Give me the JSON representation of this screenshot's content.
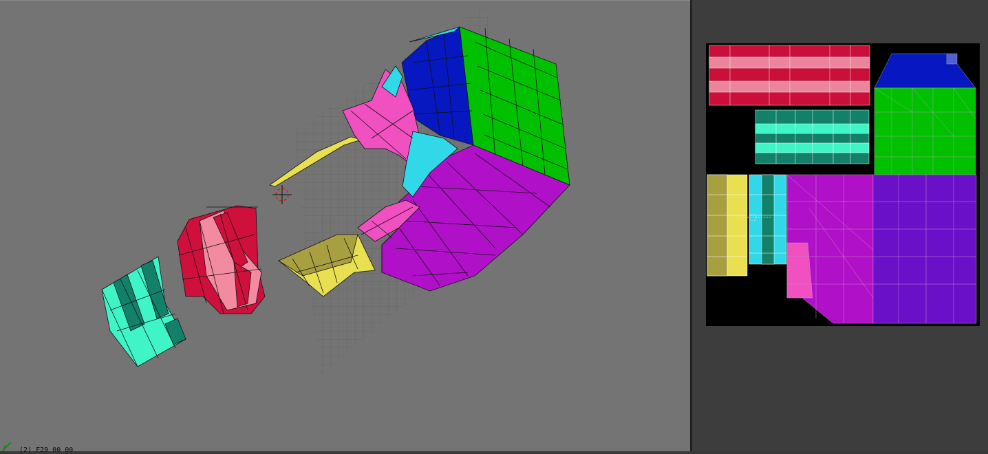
{
  "viewport": {
    "status_text": "(2) F29 00 00"
  },
  "uv_editor": {
    "islands": [
      "red-pink-stripes",
      "teal-stripes",
      "blue-cap",
      "green-side",
      "yellow-strip",
      "cyan-strip",
      "magenta-face",
      "purple-face"
    ]
  },
  "colors": {
    "viewport_bg": "#747474",
    "panel_bg": "#3d3d3d",
    "red": "#d0103c",
    "pink": "#f28aa0",
    "teal_dark": "#13806a",
    "teal_light": "#3ff5c8",
    "blue": "#0818c0",
    "green": "#00c000",
    "yellow": "#e8e050",
    "olive": "#a8a040",
    "cyan": "#30d8e8",
    "magenta": "#b010c8",
    "purple": "#6a10c8",
    "hot_pink": "#f050c0"
  },
  "icons": [
    "axis-gizmo-icon",
    "3d-cursor-icon",
    "uv-cursor-icon"
  ]
}
